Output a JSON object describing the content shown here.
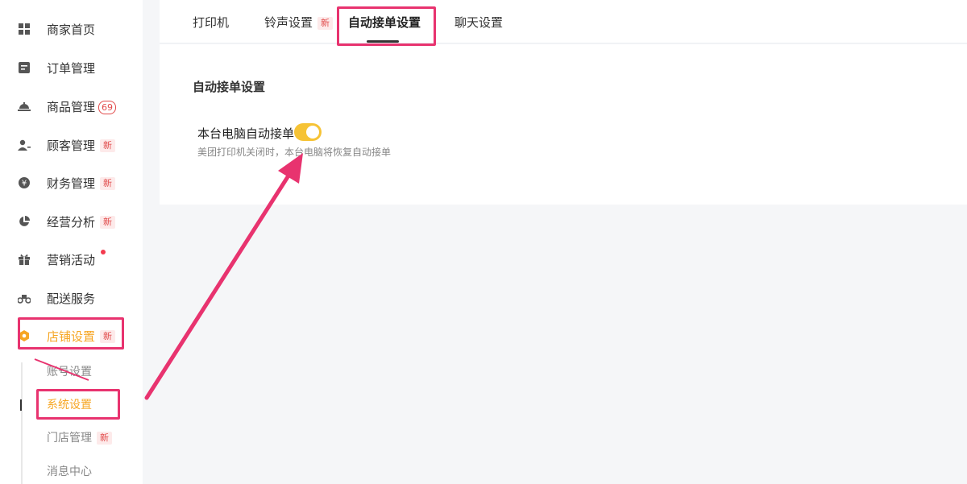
{
  "sidebar": {
    "items": [
      {
        "label": "商家首页",
        "icon": "dashboard-icon"
      },
      {
        "label": "订单管理",
        "icon": "order-icon"
      },
      {
        "label": "商品管理",
        "icon": "goods-icon",
        "count": "69"
      },
      {
        "label": "顾客管理",
        "icon": "customer-icon",
        "badge": "新"
      },
      {
        "label": "财务管理",
        "icon": "finance-icon",
        "badge": "新"
      },
      {
        "label": "经营分析",
        "icon": "analysis-icon",
        "badge": "新"
      },
      {
        "label": "营销活动",
        "icon": "gift-icon"
      },
      {
        "label": "配送服务",
        "icon": "delivery-icon"
      },
      {
        "label": "店铺设置",
        "icon": "store-settings-icon",
        "badge": "新"
      }
    ],
    "sub_items": [
      {
        "label": "账号设置"
      },
      {
        "label": "系统设置"
      },
      {
        "label": "门店管理",
        "badge": "新"
      },
      {
        "label": "消息中心"
      }
    ]
  },
  "tabs": [
    {
      "label": "打印机"
    },
    {
      "label": "铃声设置",
      "badge": "新"
    },
    {
      "label": "自动接单设置"
    },
    {
      "label": "聊天设置"
    }
  ],
  "content": {
    "section_title": "自动接单设置",
    "toggle_label": "本台电脑自动接单",
    "toggle_on": true,
    "hint": "美团打印机关闭时，本台电脑将恢复自动接单"
  },
  "colors": {
    "accent": "#f6a623",
    "toggle": "#f6c335",
    "badge_red": "#e14a4a",
    "highlight": "#e8336f"
  }
}
